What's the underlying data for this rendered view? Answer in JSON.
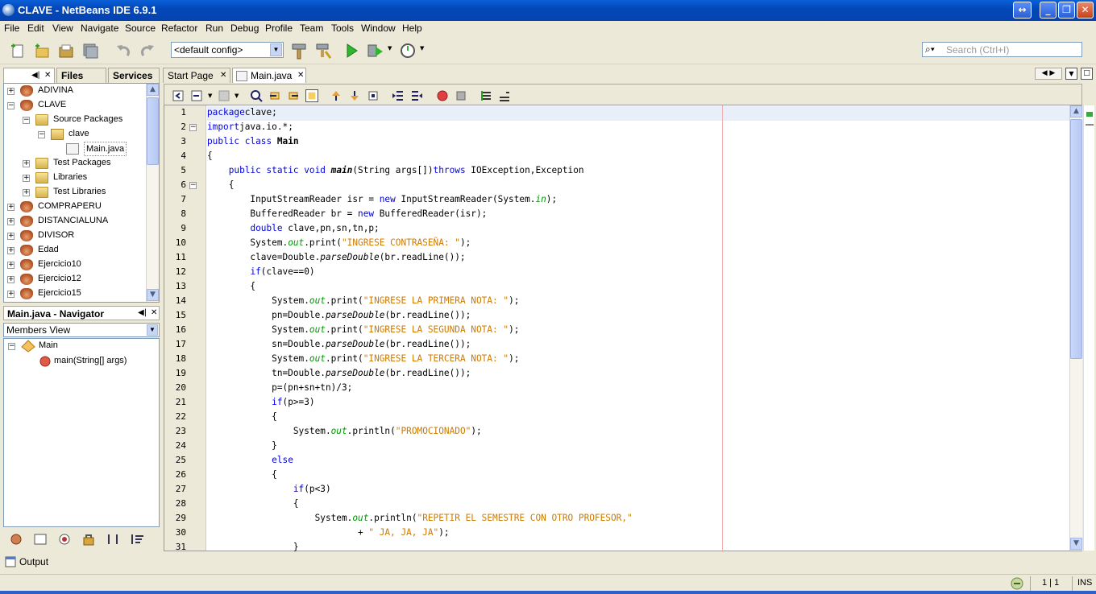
{
  "window": {
    "title": "CLAVE - NetBeans IDE 6.9.1"
  },
  "menu": [
    "File",
    "Edit",
    "View",
    "Navigate",
    "Source",
    "Refactor",
    "Run",
    "Debug",
    "Profile",
    "Team",
    "Tools",
    "Window",
    "Help"
  ],
  "toolbar": {
    "config": "<default config>",
    "search_placeholder": "Search (Ctrl+I)"
  },
  "projects_panel": {
    "tabs": [
      "Files",
      "Services"
    ],
    "tree": [
      {
        "label": "ADIVINA",
        "level": 0,
        "type": "project",
        "expanded": false
      },
      {
        "label": "CLAVE",
        "level": 0,
        "type": "project",
        "expanded": true
      },
      {
        "label": "Source Packages",
        "level": 1,
        "type": "folder",
        "expanded": true
      },
      {
        "label": "clave",
        "level": 2,
        "type": "package",
        "expanded": true
      },
      {
        "label": "Main.java",
        "level": 3,
        "type": "java"
      },
      {
        "label": "Test Packages",
        "level": 1,
        "type": "folder",
        "expanded": false
      },
      {
        "label": "Libraries",
        "level": 1,
        "type": "folder",
        "expanded": false
      },
      {
        "label": "Test Libraries",
        "level": 1,
        "type": "folder",
        "expanded": false
      },
      {
        "label": "COMPRAPERU",
        "level": 0,
        "type": "project",
        "expanded": false
      },
      {
        "label": "DISTANCIALUNA",
        "level": 0,
        "type": "project",
        "expanded": false
      },
      {
        "label": "DIVISOR",
        "level": 0,
        "type": "project",
        "expanded": false
      },
      {
        "label": "Edad",
        "level": 0,
        "type": "project",
        "expanded": false
      },
      {
        "label": "Ejercicio10",
        "level": 0,
        "type": "project",
        "expanded": false
      },
      {
        "label": "Ejercicio12",
        "level": 0,
        "type": "project",
        "expanded": false
      },
      {
        "label": "Ejercicio15",
        "level": 0,
        "type": "project",
        "expanded": false
      }
    ]
  },
  "navigator": {
    "title": "Main.java - Navigator",
    "view": "Members View",
    "items": [
      "Main",
      "main(String[] args)"
    ]
  },
  "editor_tabs": [
    "Start Page",
    "Main.java"
  ],
  "code_lines": [
    [
      [
        "kw",
        "package"
      ],
      [
        "",
        "clave;"
      ]
    ],
    [
      [
        "kw",
        "import"
      ],
      [
        "",
        "java.io.*;"
      ]
    ],
    [
      [
        "kw",
        "public class"
      ],
      [
        "",
        " "
      ],
      [
        "bold",
        "Main"
      ]
    ],
    [
      [
        "",
        "{"
      ]
    ],
    [
      [
        "",
        "    "
      ],
      [
        "kw",
        "public static void"
      ],
      [
        "",
        " "
      ],
      [
        "bi",
        "main"
      ],
      [
        "",
        "(String args[])"
      ],
      [
        "kw",
        "throws"
      ],
      [
        "",
        " IOException,Exception"
      ]
    ],
    [
      [
        "",
        "    {"
      ]
    ],
    [
      [
        "",
        "        InputStreamReader isr = "
      ],
      [
        "kw",
        "new"
      ],
      [
        "",
        " InputStreamReader(System."
      ],
      [
        "fld",
        "in"
      ],
      [
        "",
        ");"
      ]
    ],
    [
      [
        "",
        "        BufferedReader br = "
      ],
      [
        "kw",
        "new"
      ],
      [
        "",
        " BufferedReader(isr);"
      ]
    ],
    [
      [
        "",
        "        "
      ],
      [
        "kw",
        "double"
      ],
      [
        "",
        " clave,pn,sn,tn,p;"
      ]
    ],
    [
      [
        "",
        "        System."
      ],
      [
        "fld",
        "out"
      ],
      [
        "",
        ".print("
      ],
      [
        "str",
        "\"INGRESE CONTRASEÑA: \""
      ],
      [
        "",
        ");"
      ]
    ],
    [
      [
        "",
        "        clave=Double."
      ],
      [
        "mst",
        "parseDouble"
      ],
      [
        "",
        "(br.readLine());"
      ]
    ],
    [
      [
        "",
        "        "
      ],
      [
        "kw",
        "if"
      ],
      [
        "",
        "(clave==0)"
      ]
    ],
    [
      [
        "",
        "        {"
      ]
    ],
    [
      [
        "",
        "            System."
      ],
      [
        "fld",
        "out"
      ],
      [
        "",
        ".print("
      ],
      [
        "str",
        "\"INGRESE LA PRIMERA NOTA: \""
      ],
      [
        "",
        ");"
      ]
    ],
    [
      [
        "",
        "            pn=Double."
      ],
      [
        "mst",
        "parseDouble"
      ],
      [
        "",
        "(br.readLine());"
      ]
    ],
    [
      [
        "",
        "            System."
      ],
      [
        "fld",
        "out"
      ],
      [
        "",
        ".print("
      ],
      [
        "str",
        "\"INGRESE LA SEGUNDA NOTA: \""
      ],
      [
        "",
        ");"
      ]
    ],
    [
      [
        "",
        "            sn=Double."
      ],
      [
        "mst",
        "parseDouble"
      ],
      [
        "",
        "(br.readLine());"
      ]
    ],
    [
      [
        "",
        "            System."
      ],
      [
        "fld",
        "out"
      ],
      [
        "",
        ".print("
      ],
      [
        "str",
        "\"INGRESE LA TERCERA NOTA: \""
      ],
      [
        "",
        ");"
      ]
    ],
    [
      [
        "",
        "            tn=Double."
      ],
      [
        "mst",
        "parseDouble"
      ],
      [
        "",
        "(br.readLine());"
      ]
    ],
    [
      [
        "",
        "            p=(pn+sn+tn)/3;"
      ]
    ],
    [
      [
        "",
        "            "
      ],
      [
        "kw",
        "if"
      ],
      [
        "",
        "(p>=3)"
      ]
    ],
    [
      [
        "",
        "            {"
      ]
    ],
    [
      [
        "",
        "                System."
      ],
      [
        "fld",
        "out"
      ],
      [
        "",
        ".println("
      ],
      [
        "str",
        "\"PROMOCIONADO\""
      ],
      [
        "",
        ");"
      ]
    ],
    [
      [
        "",
        "            }"
      ]
    ],
    [
      [
        "",
        "            "
      ],
      [
        "kw",
        "else"
      ]
    ],
    [
      [
        "",
        "            {"
      ]
    ],
    [
      [
        "",
        "                "
      ],
      [
        "kw",
        "if"
      ],
      [
        "",
        "(p<3)"
      ]
    ],
    [
      [
        "",
        "                {"
      ]
    ],
    [
      [
        "",
        "                    System."
      ],
      [
        "fld",
        "out"
      ],
      [
        "",
        ".println("
      ],
      [
        "str",
        "\"REPETIR EL SEMESTRE CON OTRO PROFESOR,\""
      ]
    ],
    [
      [
        "",
        "                            + "
      ],
      [
        "str",
        "\" JA, JA, JA\""
      ],
      [
        "",
        ");"
      ]
    ],
    [
      [
        "",
        "                }"
      ]
    ]
  ],
  "output": {
    "label": "Output"
  },
  "status": {
    "position": "1 | 1",
    "mode": "INS"
  }
}
